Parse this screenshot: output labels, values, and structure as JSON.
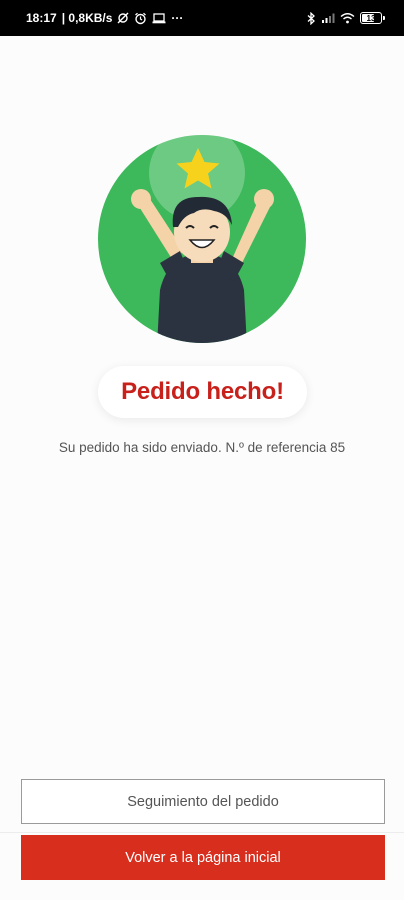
{
  "status_bar": {
    "time": "18:17",
    "speed": "| 0,8KB/s",
    "more": "···",
    "battery": "13",
    "icons": [
      "sync-off-icon",
      "alarm-icon",
      "laptop-icon",
      "bluetooth-icon",
      "signal-icon",
      "wifi-icon",
      "battery-icon"
    ]
  },
  "confirmation": {
    "title": "Pedido hecho!",
    "message": "Su pedido ha sido enviado. N.º de referencia 85"
  },
  "actions": {
    "track_label": "Seguimiento del pedido",
    "home_label": "Volver a la página inicial"
  },
  "colors": {
    "accent_red": "#d72e1e",
    "title_red": "#c8201a",
    "circle_green": "#3db85a",
    "star_yellow": "#f7d21c"
  }
}
